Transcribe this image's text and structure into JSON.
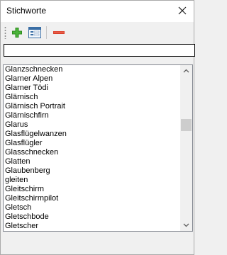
{
  "window": {
    "title": "Stichworte"
  },
  "toolbar": {
    "add_icon": "plus-icon",
    "edit_icon": "edit-form-icon",
    "remove_icon": "minus-icon",
    "add_color": "#2e8b1e",
    "remove_color": "#d9402b"
  },
  "search": {
    "value": ""
  },
  "list": {
    "items": [
      "Glanzschnecken",
      "Glarner Alpen",
      "Glarner Tödi",
      "Glärnisch",
      "Glärnisch Portrait",
      "Glärnischfirn",
      "Glarus",
      "Glasflügelwanzen",
      "Glasflügler",
      "Glasschnecken",
      "Glatten",
      "Glaubenberg",
      "gleiten",
      "Gleitschirm",
      "Gleitschirmpilot",
      "Gletsch",
      "Gletschbode",
      "Gletscher"
    ]
  }
}
